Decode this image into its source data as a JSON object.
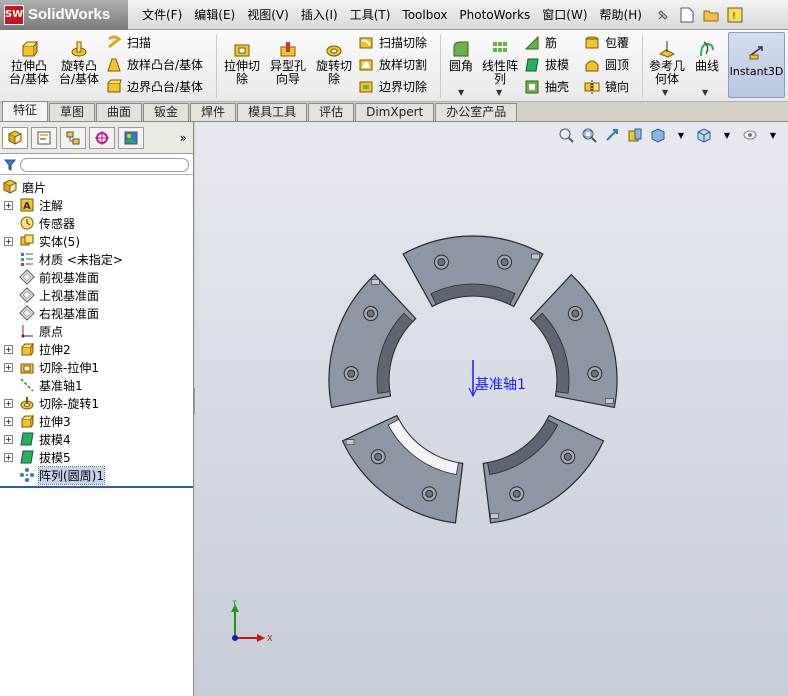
{
  "app": {
    "brand": "SolidWorks",
    "badge": "SW"
  },
  "menu": [
    "文件(F)",
    "编辑(E)",
    "视图(V)",
    "插入(I)",
    "工具(T)",
    "Toolbox",
    "PhotoWorks",
    "窗口(W)",
    "帮助(H)"
  ],
  "ribbon": {
    "extrude_boss": "拉伸凸\n台/基体",
    "revolve_boss": "旋转凸\n台/基体",
    "sweep": "扫描",
    "loft_boss": "放样凸台/基体",
    "boundary_boss": "边界凸台/基体",
    "extrude_cut": "拉伸切\n除",
    "hole_wizard": "异型孔\n向导",
    "revolve_cut": "旋转切\n除",
    "sweep_cut": "扫描切除",
    "loft_cut": "放样切割",
    "boundary_cut": "边界切除",
    "fillet": "圆角",
    "linear_pattern": "线性阵\n列",
    "rib": "筋",
    "draft": "拔模",
    "shell": "抽壳",
    "wrap": "包覆",
    "dome": "圆顶",
    "mirror": "镜向",
    "ref_geometry": "参考几\n何体",
    "curves": "曲线",
    "instant3d": "Instant3D"
  },
  "tabs": [
    "特征",
    "草图",
    "曲面",
    "钣金",
    "焊件",
    "模具工具",
    "评估",
    "DimXpert",
    "办公室产品"
  ],
  "active_tab": "特征",
  "tree": {
    "root": "磨片",
    "items": [
      {
        "label": "注解",
        "expandable": true,
        "icon": "annotation-icon"
      },
      {
        "label": "传感器",
        "expandable": false,
        "icon": "sensor-icon"
      },
      {
        "label": "实体(5)",
        "expandable": true,
        "icon": "solid-bodies-icon"
      },
      {
        "label": "材质 <未指定>",
        "expandable": false,
        "icon": "material-icon"
      },
      {
        "label": "前视基准面",
        "expandable": false,
        "icon": "plane-icon"
      },
      {
        "label": "上视基准面",
        "expandable": false,
        "icon": "plane-icon"
      },
      {
        "label": "右视基准面",
        "expandable": false,
        "icon": "plane-icon"
      },
      {
        "label": "原点",
        "expandable": false,
        "icon": "origin-icon"
      },
      {
        "label": "拉伸2",
        "expandable": true,
        "icon": "extrude-icon"
      },
      {
        "label": "切除-拉伸1",
        "expandable": true,
        "icon": "cut-extrude-icon"
      },
      {
        "label": "基准轴1",
        "expandable": false,
        "icon": "axis-icon"
      },
      {
        "label": "切除-旋转1",
        "expandable": true,
        "icon": "cut-revolve-icon"
      },
      {
        "label": "拉伸3",
        "expandable": true,
        "icon": "extrude-icon"
      },
      {
        "label": "拔模4",
        "expandable": true,
        "icon": "draft-icon"
      },
      {
        "label": "拔模5",
        "expandable": true,
        "icon": "draft-icon"
      },
      {
        "label": "阵列(圆周)1",
        "expandable": false,
        "icon": "circular-pattern-icon",
        "selected": true
      }
    ]
  },
  "viewport": {
    "axis_label": "基准轴1",
    "triad_x": "X",
    "triad_y": "Y"
  },
  "colors": {
    "part_fill": "#8f96a6",
    "part_edge": "#2a2a2a",
    "axis_blue": "#1a1aff",
    "selection": "#c6d3ea"
  }
}
